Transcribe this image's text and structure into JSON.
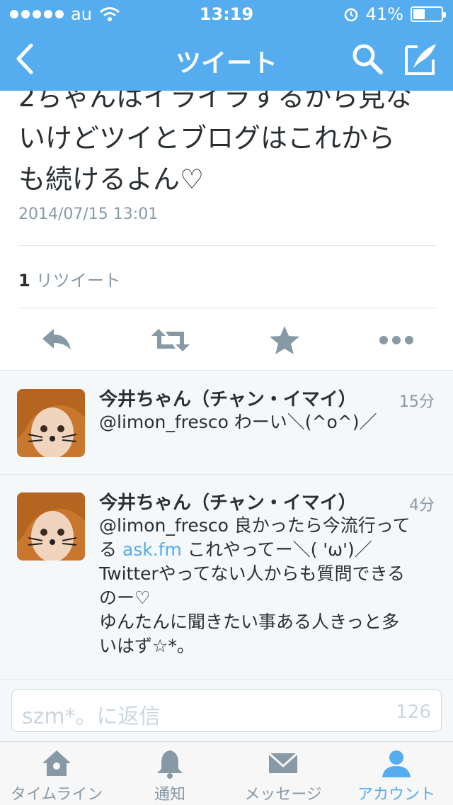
{
  "status_bar": {
    "carrier": "au",
    "time": "13:19",
    "battery_percent": "41%",
    "battery_level": 0.41
  },
  "nav": {
    "title": "ツイート",
    "back_icon": "chevron-left-icon",
    "search_icon": "search-icon",
    "compose_icon": "compose-icon"
  },
  "tweet": {
    "text_line1": "2ちゃんはイライラするから見な",
    "text_line2": "いけどツイとブログはこれから",
    "text_line3": "も続けるよん♡",
    "date": "2014/07/15 13:01",
    "retweet_count": "1",
    "retweet_label": "リツイート"
  },
  "replies": [
    {
      "name": "今井ちゃん（チャン・イマイ）",
      "time": "15分",
      "line1": "@limon_fresco わーい＼(^o^)／"
    },
    {
      "name": "今井ちゃん（チャン・イマイ）",
      "time": "4分",
      "line1": "@limon_fresco 良かったら今流行って",
      "line2_pre": "る ",
      "line2_link": "ask.fm",
      "line2_post": " これやってー＼( 'ω')／",
      "line3": "Twitterやってない人からも質問できる",
      "line4": "のー♡",
      "line5": "ゆんたんに聞きたい事ある人きっと多",
      "line6": "いはず☆*。"
    }
  ],
  "reply_box": {
    "placeholder": "szm*。に返信",
    "char_count": "126"
  },
  "tabs": [
    {
      "label": "タイムライン",
      "icon": "home-icon"
    },
    {
      "label": "通知",
      "icon": "bell-icon"
    },
    {
      "label": "メッセージ",
      "icon": "envelope-icon"
    },
    {
      "label": "アカウント",
      "icon": "person-icon"
    }
  ],
  "colors": {
    "accent": "#55acee",
    "text": "#292f33",
    "muted": "#8899a6"
  }
}
